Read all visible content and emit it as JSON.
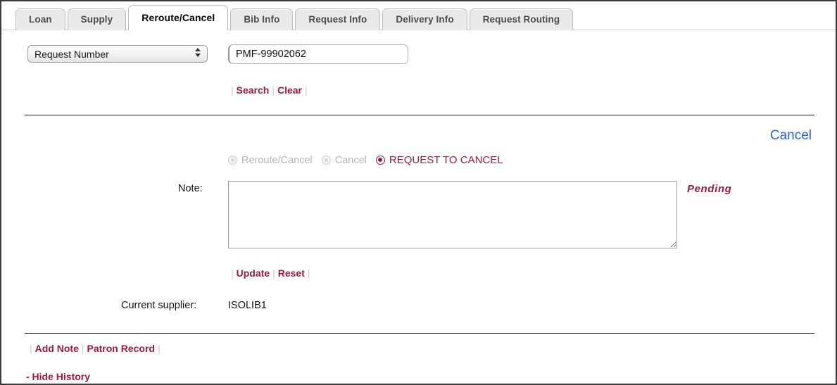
{
  "tabs": [
    {
      "label": "Loan",
      "active": false
    },
    {
      "label": "Supply",
      "active": false
    },
    {
      "label": "Reroute/Cancel",
      "active": true
    },
    {
      "label": "Bib Info",
      "active": false
    },
    {
      "label": "Request Info",
      "active": false
    },
    {
      "label": "Delivery Info",
      "active": false
    },
    {
      "label": "Request Routing",
      "active": false
    }
  ],
  "search": {
    "field_selector_value": "Request Number",
    "field_selector_options": [
      "Request Number"
    ],
    "query_value": "PMF-99902062",
    "query_placeholder": "",
    "search_label": "Search",
    "clear_label": "Clear"
  },
  "actions": {
    "cancel_link_label": "Cancel"
  },
  "radios": [
    {
      "label": "Reroute/Cancel",
      "selected": false,
      "disabled": true
    },
    {
      "label": "Cancel",
      "selected": false,
      "disabled": true
    },
    {
      "label": "REQUEST TO CANCEL",
      "selected": true,
      "disabled": false
    }
  ],
  "note": {
    "label": "Note:",
    "value": "",
    "placeholder": "",
    "status_text": "Pending",
    "update_label": "Update",
    "reset_label": "Reset"
  },
  "supplier": {
    "label": "Current supplier:",
    "value": "ISOLIB1"
  },
  "footer": {
    "add_note_label": "Add Note",
    "patron_record_label": "Patron Record",
    "history_toggle_label": "- Hide History"
  },
  "colors": {
    "link_red": "#9b1b38",
    "link_blue": "#2a62e0",
    "status_red": "#9b1b38",
    "tab_inactive_bg": "#e9e9e9",
    "tab_active_bg": "#ffffff",
    "disabled_gray": "#b6b6b6"
  }
}
